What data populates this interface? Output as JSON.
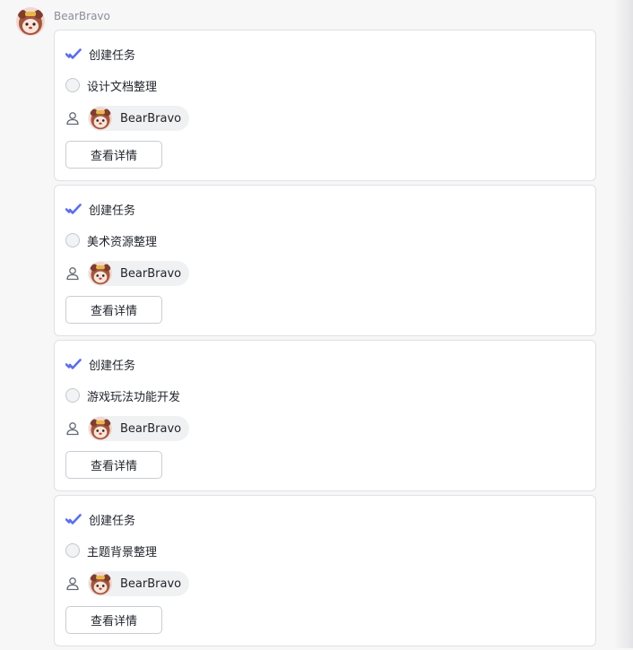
{
  "header": {
    "sender_name": "BearBravo"
  },
  "colors": {
    "accent_check": "#5b6ee8",
    "card_border": "#dfe1e5",
    "chip_bg": "#f0f1f3"
  },
  "icons": {
    "check": "double-check-icon",
    "radio": "radio-circle-icon",
    "person": "person-icon",
    "avatar": "bear-avatar"
  },
  "cards": [
    {
      "create_label": "创建任务",
      "task_name": "设计文档整理",
      "owner_name": "BearBravo",
      "detail_button": "查看详情"
    },
    {
      "create_label": "创建任务",
      "task_name": "美术资源整理",
      "owner_name": "BearBravo",
      "detail_button": "查看详情"
    },
    {
      "create_label": "创建任务",
      "task_name": "游戏玩法功能开发",
      "owner_name": "BearBravo",
      "detail_button": "查看详情"
    },
    {
      "create_label": "创建任务",
      "task_name": "主题背景整理",
      "owner_name": "BearBravo",
      "detail_button": "查看详情"
    }
  ]
}
